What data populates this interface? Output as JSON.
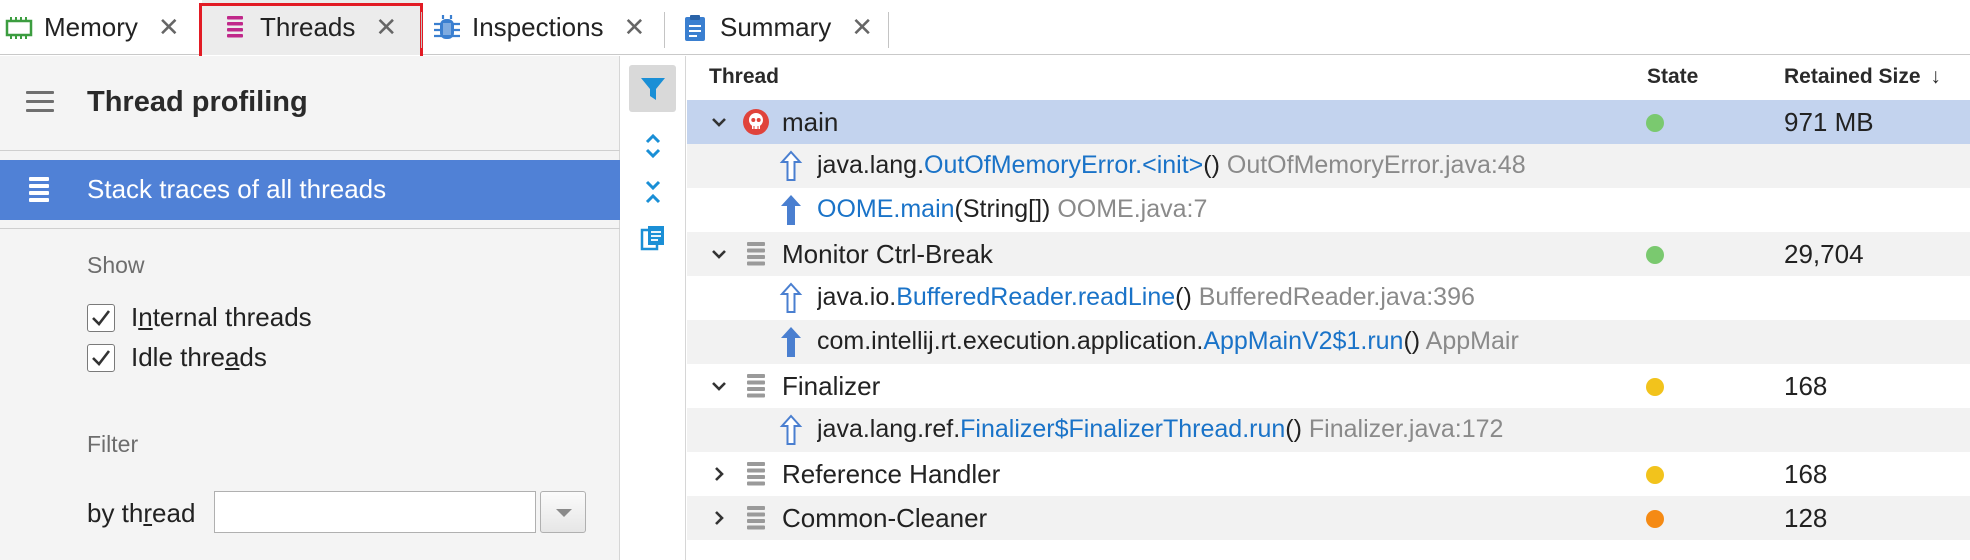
{
  "tabs": [
    {
      "label": "Memory",
      "icon": "memory-chip-icon",
      "color": "#3c9d40"
    },
    {
      "label": "Threads",
      "icon": "threads-icon",
      "color": "#c0288a",
      "active": true
    },
    {
      "label": "Inspections",
      "icon": "bug-icon",
      "color": "#3a7fd0"
    },
    {
      "label": "Summary",
      "icon": "clipboard-icon",
      "color": "#3a7fd0"
    }
  ],
  "left_panel": {
    "title": "Thread profiling",
    "nav_item": "Stack traces of all threads",
    "show_label": "Show",
    "internal_threads": {
      "label_pre": "I",
      "label_underline": "n",
      "label_post": "ternal threads",
      "checked": true
    },
    "idle_threads": {
      "label_pre": "Idle thre",
      "label_underline": "a",
      "label_post": "ds",
      "checked": true
    },
    "filter_label": "Filter",
    "by_thread": {
      "label_pre": "by th",
      "label_underline": "r",
      "label_post": "ead",
      "value": ""
    }
  },
  "table": {
    "headers": {
      "thread": "Thread",
      "state": "State",
      "retained": "Retained Size"
    },
    "rows": [
      {
        "kind": "thread",
        "name": "main",
        "expanded": true,
        "icon": "skull-icon",
        "state_color": "#7ac96f",
        "size": "971 MB",
        "selected": true
      },
      {
        "kind": "frame",
        "arrow": "outline",
        "pkg": "java.lang.",
        "method": "OutOfMemoryError.<init>",
        "args": "()",
        "file": "OutOfMemoryError.java:48"
      },
      {
        "kind": "frame",
        "arrow": "solid",
        "pkg": "",
        "method": "OOME.main",
        "args": "(String[])",
        "file": "OOME.java:7"
      },
      {
        "kind": "thread",
        "name": "Monitor Ctrl-Break",
        "expanded": true,
        "icon": "thread-icon",
        "state_color": "#7ac96f",
        "size": "29,704"
      },
      {
        "kind": "frame",
        "arrow": "outline",
        "pkg": "java.io.",
        "method": "BufferedReader.readLine",
        "args": "()",
        "file": "BufferedReader.java:396"
      },
      {
        "kind": "frame",
        "arrow": "solid",
        "pkg": "com.intellij.rt.execution.application.",
        "method": "AppMainV2$1.run",
        "args": "()",
        "file": "AppMair"
      },
      {
        "kind": "thread",
        "name": "Finalizer",
        "expanded": true,
        "icon": "thread-icon",
        "state_color": "#f2c31c",
        "size": "168"
      },
      {
        "kind": "frame",
        "arrow": "outline",
        "pkg": "java.lang.ref.",
        "method": "Finalizer$FinalizerThread.run",
        "args": "()",
        "file": "Finalizer.java:172"
      },
      {
        "kind": "thread",
        "name": "Reference Handler",
        "expanded": false,
        "icon": "thread-icon",
        "state_color": "#f2c31c",
        "size": "168"
      },
      {
        "kind": "thread",
        "name": "Common-Cleaner",
        "expanded": false,
        "icon": "thread-icon",
        "state_color": "#f58a14",
        "size": "128"
      }
    ]
  },
  "colors": {
    "selection": "#5081d6",
    "row_selected": "#c3d3ee",
    "link": "#1a73c8",
    "tab_highlight": "#e21b24"
  }
}
